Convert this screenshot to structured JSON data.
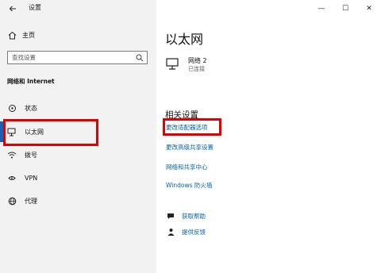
{
  "window": {
    "title": "设置",
    "controls": {
      "minimize": "—",
      "maximize": "☐",
      "close": "✕"
    }
  },
  "sidebar": {
    "home_label": "主页",
    "search_placeholder": "查找设置",
    "section_title": "网络和 Internet",
    "items": [
      {
        "label": "状态",
        "icon": "status-icon"
      },
      {
        "label": "以太网",
        "icon": "ethernet-icon"
      },
      {
        "label": "拨号",
        "icon": "dialup-icon"
      },
      {
        "label": "VPN",
        "icon": "vpn-icon"
      },
      {
        "label": "代理",
        "icon": "globe-icon"
      }
    ]
  },
  "main": {
    "page_title": "以太网",
    "network": {
      "name": "网络 2",
      "status": "已连接"
    },
    "related_title": "相关设置",
    "links": [
      "更改适配器选项",
      "更改高级共享设置",
      "网络和共享中心",
      "Windows 防火墙"
    ],
    "help": [
      {
        "label": "获取帮助",
        "icon": "help-chat-icon"
      },
      {
        "label": "提供反馈",
        "icon": "feedback-icon"
      }
    ]
  },
  "colors": {
    "accent": "#1a5fb4",
    "link": "#0063b1",
    "highlight": "#e00000",
    "sidebar_bg": "#f2f2f2"
  }
}
